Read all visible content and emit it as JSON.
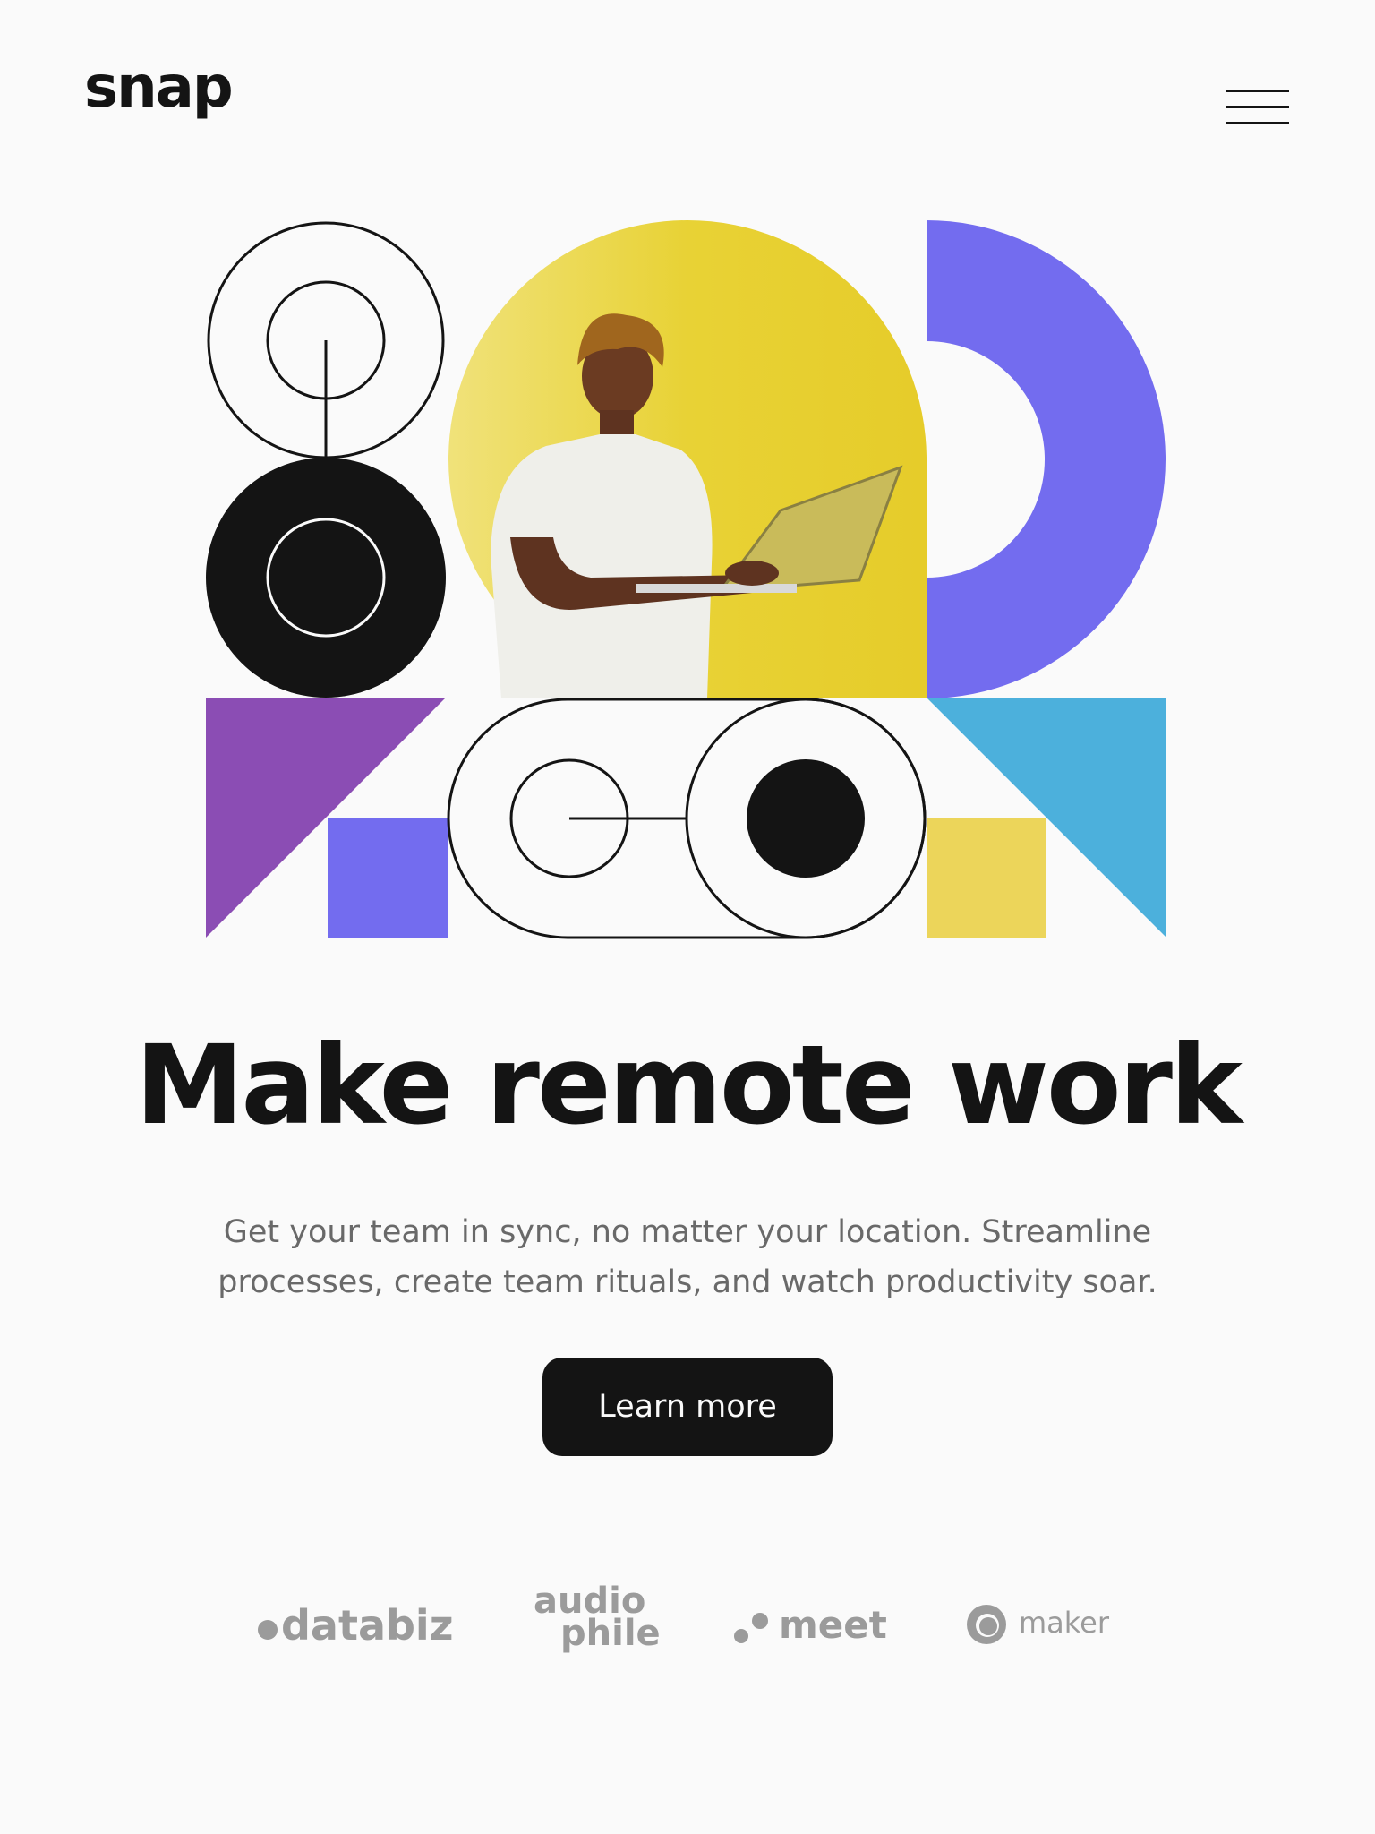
{
  "header": {
    "logo_text": "snap",
    "menu_icon": "hamburger-menu-icon"
  },
  "hero": {
    "headline": "Make remote work",
    "subtext": "Get your team in sync, no matter your location. Streamline processes, create team rituals, and watch productivity soar.",
    "cta_label": "Learn more"
  },
  "clients": {
    "databiz": "databiz",
    "audiophile_top": "audio",
    "audiophile_bottom": "phile",
    "meet": "meet",
    "maker": "maker"
  },
  "colors": {
    "background": "#fafafa",
    "text_dark": "#141414",
    "text_gray": "#696969",
    "client_gray": "#9b9b9b",
    "yellow": "#e6d033",
    "purple_blue": "#736cef",
    "purple": "#8b4db4",
    "sky_blue": "#4cb0dc",
    "light_yellow": "#ecd55a"
  }
}
